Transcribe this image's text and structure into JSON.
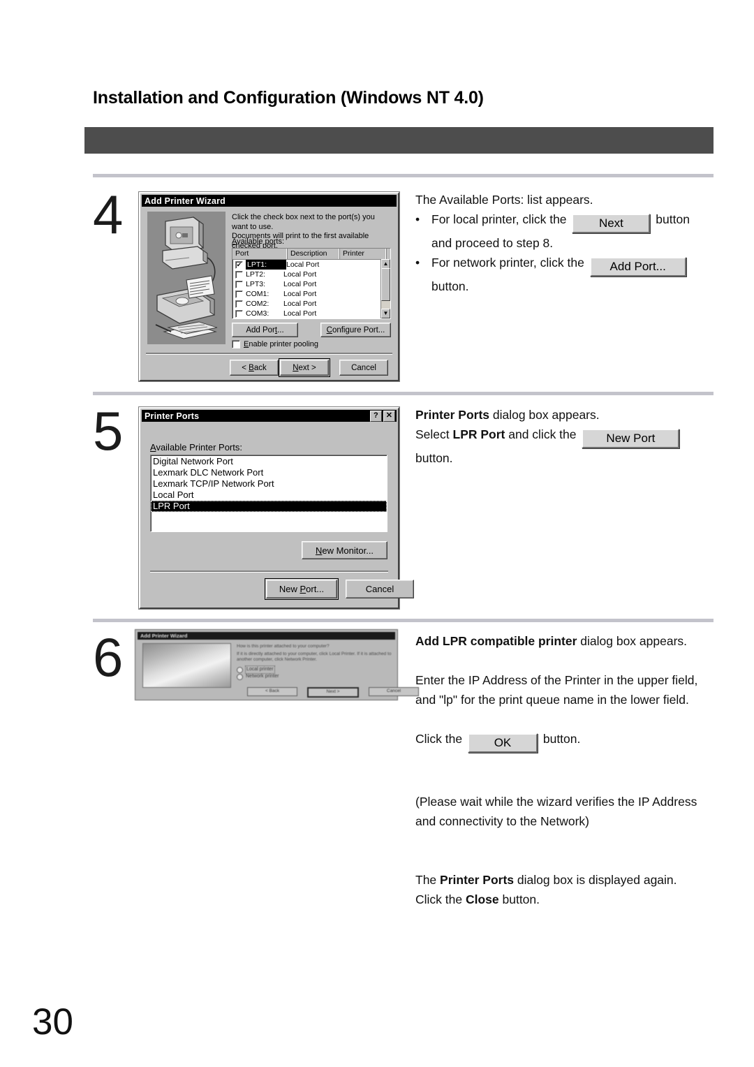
{
  "page": {
    "title": "Installation and Configuration (Windows NT 4.0)",
    "number": "30"
  },
  "steps": [
    {
      "number": "4",
      "text": {
        "line1": "The Available Ports: list appears.",
        "bullet_dot": "•",
        "b1_pre": "For local printer, click the",
        "b1_button": "Next",
        "b1_post": "button",
        "b1_cont": "and proceed to step 8.",
        "b2_pre": "For network printer, click the",
        "b2_button": "Add Port...",
        "b2_cont": "button."
      }
    },
    {
      "number": "5",
      "text": {
        "l1_bold": "Printer Ports",
        "l1_rest": " dialog box appears.",
        "l2_pre": "Select ",
        "l2_bold": "LPR Port",
        "l2_mid": " and click the",
        "l2_button": "New Port",
        "l3": "button."
      }
    },
    {
      "number": "6",
      "text": {
        "l1_bold": "Add LPR compatible printer",
        "l1_rest": " dialog box appears.",
        "p2a": "Enter the IP Address of the Printer in the upper field,",
        "p2b": "and \"lp\" for the print queue name in the lower field.",
        "p3_pre": "Click the",
        "p3_button": "OK",
        "p3_post": "button.",
        "p4a": "(Please wait while the wizard verifies the IP Address",
        "p4b": "and connectivity to the Network)",
        "p5_pre": "The ",
        "p5_bold": "Printer Ports",
        "p5_rest": " dialog box is displayed again.",
        "p6_pre": "Click the ",
        "p6_bold": "Close",
        "p6_rest": " button."
      }
    }
  ],
  "dialog_add_printer_wizard": {
    "title": "Add Printer Wizard",
    "intro_line1": "Click the check box next to the port(s) you want to use.",
    "intro_line2": "Documents will print to the first available checked port.",
    "available_ports_label": "Available ports:",
    "columns": [
      "Port",
      "Description",
      "Printer"
    ],
    "rows": [
      {
        "checked": "✔",
        "port": "LPT1:",
        "description": "Local Port",
        "printer": "",
        "selected": true
      },
      {
        "checked": "",
        "port": "LPT2:",
        "description": "Local Port",
        "printer": "",
        "selected": false
      },
      {
        "checked": "",
        "port": "LPT3:",
        "description": "Local Port",
        "printer": "",
        "selected": false
      },
      {
        "checked": "",
        "port": "COM1:",
        "description": "Local Port",
        "printer": "",
        "selected": false
      },
      {
        "checked": "",
        "port": "COM2:",
        "description": "Local Port",
        "printer": "",
        "selected": false
      },
      {
        "checked": "",
        "port": "COM3:",
        "description": "Local Port",
        "printer": "",
        "selected": false
      }
    ],
    "scroll_up": "▲",
    "scroll_down": "▼",
    "add_port_button": "Add Port...",
    "configure_port_button": "Configure Port...",
    "pooling_checkbox_label": "Enable printer pooling",
    "back_button": "< Back",
    "next_button": "Next >",
    "cancel_button": "Cancel"
  },
  "dialog_printer_ports": {
    "title": "Printer Ports",
    "help_button": "?",
    "close_button": "✕",
    "list_label": "Available Printer Ports:",
    "ports": [
      {
        "name": "Digital Network Port",
        "selected": false
      },
      {
        "name": "Lexmark DLC Network Port",
        "selected": false
      },
      {
        "name": "Lexmark TCP/IP Network Port",
        "selected": false
      },
      {
        "name": "Local Port",
        "selected": false
      },
      {
        "name": "LPR Port",
        "selected": true
      }
    ],
    "new_monitor_button": "New Monitor...",
    "new_port_button": "New Port...",
    "cancel_button": "Cancel"
  },
  "dialog_thumbnail": {
    "title": "Add Printer Wizard",
    "question": "How is this printer attached to your computer?",
    "description": "If it is directly attached to your computer, click Local Printer. If it is attached to another computer, click Network Printer.",
    "option_local": "Local printer",
    "option_network": "Network printer",
    "back_button": "< Back",
    "next_button": "Next >",
    "cancel_button": "Cancel"
  }
}
